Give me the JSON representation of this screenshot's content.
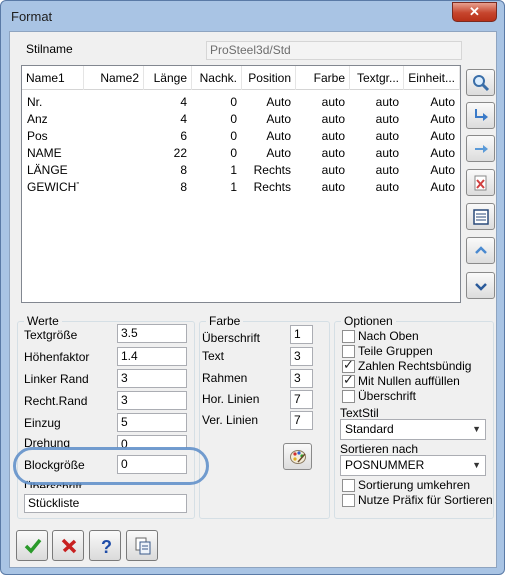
{
  "window": {
    "title": "Format",
    "close_icon": "close-icon"
  },
  "style_name": {
    "label": "Stilname",
    "value": "ProSteel3d/Std"
  },
  "list": {
    "columns": [
      "Name1",
      "Name2",
      "Länge",
      "Nachk.",
      "Position",
      "Farbe",
      "Textgr...",
      "Einheit..."
    ],
    "rows": [
      [
        "Nr.",
        "",
        "4",
        "0",
        "Auto",
        "auto",
        "auto",
        "Auto"
      ],
      [
        "Anz",
        "",
        "4",
        "0",
        "Auto",
        "auto",
        "auto",
        "Auto"
      ],
      [
        "Pos",
        "",
        "6",
        "0",
        "Auto",
        "auto",
        "auto",
        "Auto"
      ],
      [
        "NAME",
        "",
        "22",
        "0",
        "Auto",
        "auto",
        "auto",
        "Auto"
      ],
      [
        "LÄNGE",
        "",
        "8",
        "1",
        "Rechts",
        "auto",
        "auto",
        "Auto"
      ],
      [
        "GEWICHT",
        "",
        "8",
        "1",
        "Rechts",
        "auto",
        "auto",
        "Auto"
      ]
    ]
  },
  "side_buttons": [
    "search-icon",
    "move-right-icon",
    "arrow-right-icon",
    "delete-icon",
    "list-icon",
    "arrow-up-icon",
    "arrow-down-icon"
  ],
  "werte": {
    "title": "Werte",
    "fields": [
      {
        "label": "Textgröße",
        "value": "3.5"
      },
      {
        "label": "Höhenfaktor",
        "value": "1.4"
      },
      {
        "label": "Linker Rand",
        "value": "3"
      },
      {
        "label": "Recht.Rand",
        "value": "3"
      },
      {
        "label": "Einzug",
        "value": "5"
      },
      {
        "label": "Drehung",
        "value": "0"
      },
      {
        "label": "Blockgröße",
        "value": "0"
      }
    ],
    "heading_label": "Überschrift",
    "heading_value": "Stückliste"
  },
  "farbe": {
    "title": "Farbe",
    "fields": [
      {
        "label": "Überschrift",
        "value": "1"
      },
      {
        "label": "Text",
        "value": "3"
      },
      {
        "label": "Rahmen",
        "value": "3"
      },
      {
        "label": "Hor. Linien",
        "value": "7"
      },
      {
        "label": "Ver. Linien",
        "value": "7"
      }
    ],
    "palette_icon": "palette-icon"
  },
  "optionen": {
    "title": "Optionen",
    "checks": [
      {
        "label": "Nach Oben",
        "checked": false
      },
      {
        "label": "Teile Gruppen",
        "checked": false
      },
      {
        "label": "Zahlen Rechtsbündig",
        "checked": true
      },
      {
        "label": "Mit Nullen auffüllen",
        "checked": true
      },
      {
        "label": "Überschrift",
        "checked": false
      }
    ],
    "textstil_label": "TextStil",
    "textstil_value": "Standard",
    "sort_label": "Sortieren nach",
    "sort_value": "POSNUMMER",
    "bottom_checks": [
      {
        "label": "Sortierung umkehren",
        "checked": false
      },
      {
        "label": "Nutze Präfix für Sortieren",
        "checked": false
      }
    ]
  },
  "bottom_buttons": [
    "ok-check-icon",
    "cancel-x-icon",
    "help-icon",
    "copy-icon"
  ],
  "colors": {
    "accent_ring": "#5a8cc8",
    "window_frame": "#a9c4e4",
    "close_red": "#c6452d"
  }
}
